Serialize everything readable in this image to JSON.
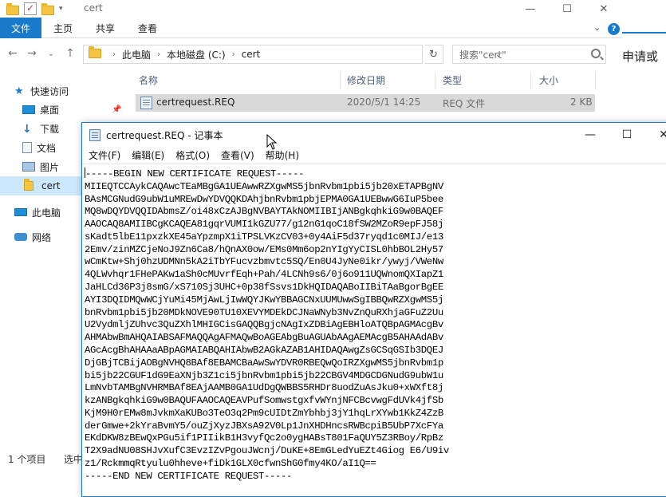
{
  "explorer": {
    "title": "cert",
    "ribbon_tabs": [
      "文件",
      "主页",
      "共享",
      "查看"
    ],
    "breadcrumb": [
      "此电脑",
      "本地磁盘 (C:)",
      "cert"
    ],
    "search_placeholder": "搜索\"cert\"",
    "columns": [
      "名称",
      "修改日期",
      "类型",
      "大小"
    ],
    "file": {
      "name": "certrequest.REQ",
      "date": "2020/5/1 14:25",
      "type": "REQ 文件",
      "size": "2 KB"
    },
    "sidebar": [
      "快速访问",
      "桌面",
      "下载",
      "文档",
      "图片",
      "cert",
      "此电脑",
      "网络"
    ],
    "status_count": "1 个项目",
    "status_selected": "选中",
    "right_edge_text": "申请或"
  },
  "notepad": {
    "title": "certrequest.REQ - 记事本",
    "menu": [
      "文件(F)",
      "编辑(E)",
      "格式(O)",
      "查看(V)",
      "帮助(H)"
    ],
    "lines": [
      "-----BEGIN NEW CERTIFICATE REQUEST-----",
      "MIIEQTCCAykCAQAwcTEaMBgGA1UEAwwRZXgwMS5jbnRvbm1pbi5jb20xETAPBgNV",
      "BAsMCGNudG9ubW1uMREwDwYDVQQKDAhjbnRvbm1pbjEPMA0GA1UEBwwG6IuP5bee",
      "MQ8wDQYDVQQIDAbmsZ/oi48xCzAJBgNVBAYTAkNOMIIBIjANBgkqhkiG9w0BAQEF",
      "AAOCAQ8AMIIBCgKCAQEA81gqrVUMI1kGZU77/g12nG1qoC18fSW2MZoR9epFJ58j",
      "sKadt5lbE11pxzkXE45aYpzmpX1iTPSLVKzCV03+0y4AiF5d37ryqd1c0MIJ/e13",
      "2Emv/zinMZCjeNoJ9Zn6Ca8/hQnAX0ow/EMs0Mm6op2nYIgYyCISL0hbBOL2Hy57",
      "wCmKtw+Shj0hzUDMNn5kA2iTbYFucvzbmvtc5SQ/En0U4JyNe0ikr/ywyj/VWeNw",
      "4QLWvhqr1FHePAKw1aSh0cMUvrfEqh+Pah/4LCNh9s6/0j6o911UQWnomQXIapZ1",
      "JaHLCd36P3j8smG/xS710Sj3UHC+0p38fSsvs1DkHQIDAQABoIIBiTAaBgorBgEE",
      "AYI3DQIDMQwWCjYuMi45MjAwLjIwWQYJKwYBBAGCNxUUMUwwSgIBBQwRZXgwMS5j",
      "bnRvbm1pbi5jb20MDkNOVE90TU10XEVYMDEkDCJNaWNyb3NvZnQuRXhjaGFuZ2Uu",
      "U2VydmljZUhvc3QuZXhlMHIGCisGAQQBgjcNAgIxZDBiAgEBHloATQBpAGMAcgBv",
      "AHMAbwBmAHQAIABSAFMAQQAgAFMAQwBoAGEAbgBuAGUAbAAgAEMAcgB5AHAAdABv",
      "AGcAcgBhAHAAaABpAGMAIABQAHIAbwB2AGkAZAB1AHIDAQAwgZsGCSqGSIb3DQEJ",
      "DjGBjTCBijAOBgNVHQ8BAf8EBAMCBaAwSwYDVR0RBEQwQoIRZXgwMS5jbnRvbm1p",
      "bi5jb22CGUF1dG9EaXNjb3Z1ci5jbnRvbm1pbi5jb22CBGV4MDGCDGNudG9ubW1u",
      "LmNvbTAMBgNVHRMBAf8EAjAAMB0GA1UdDgQWBBS5RHDr8uodZuAsJku0+xWXft8j",
      "kzANBgkqhkiG9w0BAQUFAAOCAQEAVPufSomwstgxfvWYnjNFCBcvwgFdUVk4jfSb",
      "KjM9H0rEMw8mJvkmXaKUBo3TeO3q2Pm9cUIDtZmYbhbj3jY1hqLrXYwb1KkZ4ZzB",
      "derGmwe+2kYraBvmY5/ouZjXyzJBXsA92V0Lp1JnXHDHncsRWBcpiB5UbP7XcFYa",
      "EKdDKW8zBEwQxPGu5if1PIIikB1H3vyfQc2o0ygHABsT801FaQUY5Z3RBoy/RpBz",
      "T2X9adNU08SHJvXufC3EvzIZvPgouJWcnj/DuKE+8EmGLedYuEZt4Giog E6/U9iv",
      "z1/RckmmqRtyulu0hheve+fiDk1GLX0cfwnShG0fmy4KO/aI1Q==",
      "-----END NEW CERTIFICATE REQUEST-----"
    ]
  }
}
